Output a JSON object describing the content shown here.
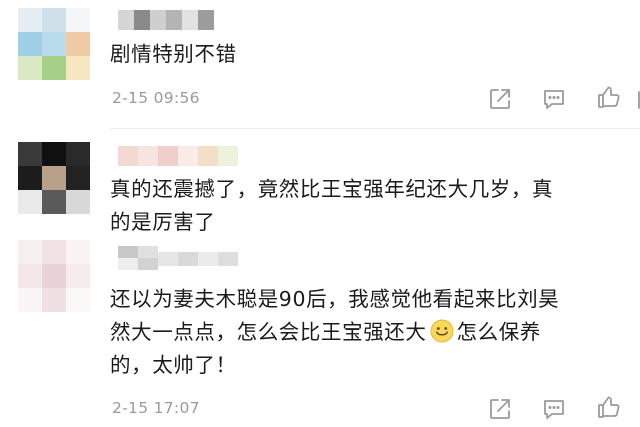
{
  "comments": [
    {
      "text_lines": [
        "剧情特别不错"
      ],
      "timestamp": "2-15 09:56",
      "actions": [
        "share-icon",
        "reply-icon",
        "like-icon"
      ]
    },
    {
      "text_lines": [
        "真的还震撼了，竟然比王宝强年纪还大几岁，真",
        "的是厉害了"
      ],
      "actions": []
    },
    {
      "text_line1": "还以为妻夫木聪是90后，我感觉他看起来比刘昊",
      "text_line2_before": "然大一点点，怎么会比王宝强还大",
      "emoji_name": "smile-emoji-icon",
      "text_line2_after": "怎么保养",
      "text_line3": "的，太帅了！",
      "timestamp": "2-15 17:07",
      "actions": [
        "share-icon",
        "reply-icon",
        "like-icon"
      ]
    }
  ],
  "colors": {
    "timestamp": "#9a9a9a",
    "text": "#1b1b1b",
    "icon": "#9b9b9b"
  }
}
